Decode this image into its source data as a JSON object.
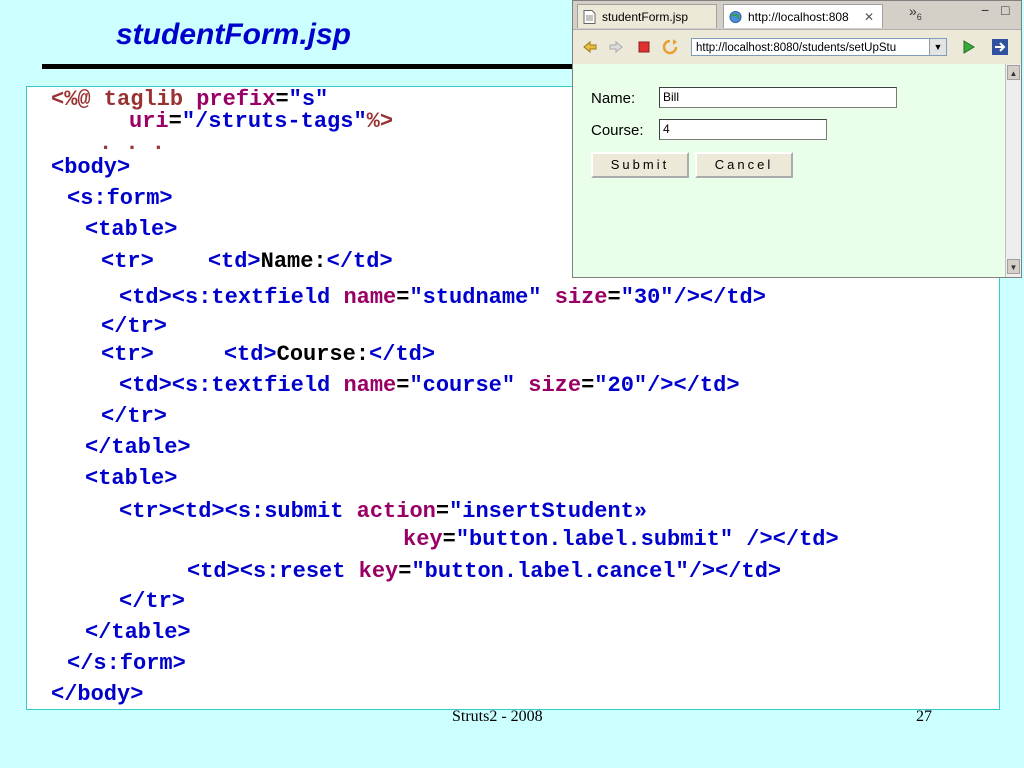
{
  "slide": {
    "title": "studentForm.jsp",
    "footer": "Struts2  - 2008",
    "page_number": "27"
  },
  "code": {
    "l1_open": "<%@",
    "l1_kw": " taglib ",
    "l1_attr": "prefix",
    "l1_eq": "=",
    "l1_val": "\"s\"",
    "l2_attr": "uri",
    "l2_eq": "=",
    "l2_val": "\"/struts-tags\"",
    "l2_close": "%>",
    "l3": ". . .",
    "l4": "<body>",
    "l5": "<s:form>",
    "l6": "<table>",
    "l7_tr": "<tr>",
    "l7_td": "<td>",
    "l7_text": "Name:",
    "l7_end": "</td>",
    "l8_open": "<td><s:textfield ",
    "l8_attr1": "name",
    "l8_eq1": "=",
    "l8_val1": "\"studname\"",
    "l8_attr2": "size",
    "l8_eq2": "=",
    "l8_val2": "\"30\"",
    "l8_close": "/></td>",
    "l9": "</tr>",
    "l10_tr": "<tr>",
    "l10_td": "<td>",
    "l10_text": "Course:",
    "l10_end": "</td>",
    "l11_open": "<td><s:textfield ",
    "l11_attr1": "name",
    "l11_eq1": "=",
    "l11_val1": "\"course\"",
    "l11_attr2": "size",
    "l11_eq2": "=",
    "l11_val2": "\"20\"",
    "l11_close": "/></td>",
    "l12": "</tr>",
    "l13": "</table>",
    "l14": "<table>",
    "l15_open": "<tr><td><s:submit ",
    "l15_attr": "action",
    "l15_eq": "=",
    "l15_val": "\"insertStudent»",
    "l16_attr": "key",
    "l16_eq": "=",
    "l16_val": "\"button.label.submit\"",
    "l16_close": " /></td>",
    "l17_open": "<td><s:reset ",
    "l17_attr": "key",
    "l17_eq": "=",
    "l17_val": "\"button.label.cancel\"",
    "l17_close": "/></td>",
    "l18": "</tr>",
    "l19": "</table>",
    "l20": "</s:form>",
    "l21": "</body>"
  },
  "browser": {
    "tabs": [
      {
        "label": "studentForm.jsp",
        "icon": "file-icon"
      },
      {
        "label": "http://localhost:808",
        "icon": "globe-icon"
      }
    ],
    "tab_close": "✕",
    "overflow_label": "»",
    "overflow_count": "6",
    "minimize": "−",
    "maximize": "□",
    "url": "http://localhost:8080/students/setUpStu",
    "url_dropdown": "▼",
    "form": {
      "name_label": "Name:",
      "name_value": "Bill",
      "course_label": "Course:",
      "course_value": "4",
      "submit_label": "Submit",
      "cancel_label": "Cancel"
    },
    "scroll_up": "▲",
    "scroll_down": "▼"
  }
}
